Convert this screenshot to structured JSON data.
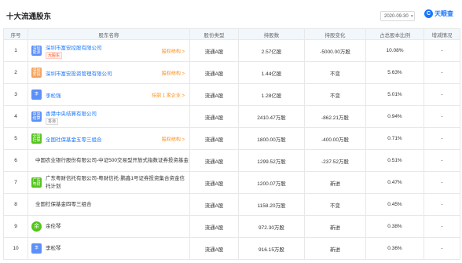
{
  "header": {
    "title": "十大流通股东",
    "date": "2020-09-30",
    "logo_mark": "C",
    "logo_text": "天眼查"
  },
  "columns": [
    "序号",
    "股东名称",
    "股份类型",
    "持股数",
    "持股变化",
    "占总股本比例",
    "增减情况"
  ],
  "colors": {
    "link": "#1677ff",
    "accent": "#fa8c16",
    "header_bg": "#f2f7fc"
  },
  "rows": [
    {
      "index": "1",
      "avatar": "深圳能源",
      "avatar_color": "#5b8ff9",
      "avatar_round": false,
      "name": "深圳市富安控股有限公司",
      "name_link": true,
      "tag": "大股东",
      "tag_grey": false,
      "right_link": "股权结构 >",
      "type": "流通A股",
      "shares": "2.57亿股",
      "change": "-5000.00万股",
      "ratio": "10.08%",
      "trend": "-"
    },
    {
      "index": "2",
      "avatar": "深圳安投",
      "avatar_color": "#f6a15a",
      "avatar_round": false,
      "name": "深圳市富安投资管理有限公司",
      "name_link": true,
      "tag": "",
      "tag_grey": false,
      "right_link": "股权结构 >",
      "type": "流通A股",
      "shares": "1.44亿股",
      "change": "不变",
      "ratio": "5.63%",
      "trend": "-"
    },
    {
      "index": "3",
      "avatar": "李",
      "avatar_color": "#5b8ff9",
      "avatar_round": false,
      "name": "李松强",
      "name_link": true,
      "tag": "",
      "tag_grey": false,
      "right_link": "任职 1 家企业 >",
      "type": "流通A股",
      "shares": "1.28亿股",
      "change": "不变",
      "ratio": "5.01%",
      "trend": "-"
    },
    {
      "index": "4",
      "avatar": "中央结算",
      "avatar_color": "#5b8ff9",
      "avatar_round": false,
      "name": "香港中央结算有限公司",
      "name_link": true,
      "tag": "香港",
      "tag_grey": true,
      "right_link": "",
      "type": "流通A股",
      "shares": "2410.47万股",
      "change": "-862.21万股",
      "ratio": "0.94%",
      "trend": "-"
    },
    {
      "index": "5",
      "avatar": "全国社保",
      "avatar_color": "#52c41a",
      "avatar_round": false,
      "name": "全国社保基金五零三组合",
      "name_link": true,
      "tag": "",
      "tag_grey": false,
      "right_link": "股权结构 >",
      "type": "流通A股",
      "shares": "1800.00万股",
      "change": "-400.00万股",
      "ratio": "0.71%",
      "trend": "-"
    },
    {
      "index": "6",
      "avatar": "",
      "avatar_color": "",
      "avatar_round": false,
      "name": "中国农业银行股份有限公司-中证500交易型开放式指数证券投资基金",
      "name_link": false,
      "tag": "",
      "tag_grey": false,
      "right_link": "",
      "type": "流通A股",
      "shares": "1299.52万股",
      "change": "-237.52万股",
      "ratio": "0.51%",
      "trend": "-"
    },
    {
      "index": "7",
      "avatar": "广东粤财",
      "avatar_color": "#52c41a",
      "avatar_round": false,
      "name": "广东粤财信托有限公司-粤财信托·鹏鑫1号证券投资集合资金信托计划",
      "name_link": false,
      "tag": "",
      "tag_grey": false,
      "right_link": "",
      "type": "流通A股",
      "shares": "1200.07万股",
      "change": "新进",
      "ratio": "0.47%",
      "trend": "-"
    },
    {
      "index": "8",
      "avatar": "",
      "avatar_color": "",
      "avatar_round": false,
      "name": "全国社保基金四零三组合",
      "name_link": false,
      "tag": "",
      "tag_grey": false,
      "right_link": "",
      "type": "流通A股",
      "shares": "1158.20万股",
      "change": "不变",
      "ratio": "0.45%",
      "trend": "-"
    },
    {
      "index": "9",
      "avatar": "余",
      "avatar_color": "#52c41a",
      "avatar_round": true,
      "name": "余伦琴",
      "name_link": false,
      "tag": "",
      "tag_grey": false,
      "right_link": "",
      "type": "流通A股",
      "shares": "972.30万股",
      "change": "新进",
      "ratio": "0.38%",
      "trend": "-"
    },
    {
      "index": "10",
      "avatar": "李",
      "avatar_color": "#5b8ff9",
      "avatar_round": false,
      "name": "李松琴",
      "name_link": false,
      "tag": "",
      "tag_grey": false,
      "right_link": "",
      "type": "流通A股",
      "shares": "916.15万股",
      "change": "新进",
      "ratio": "0.36%",
      "trend": "-"
    }
  ]
}
